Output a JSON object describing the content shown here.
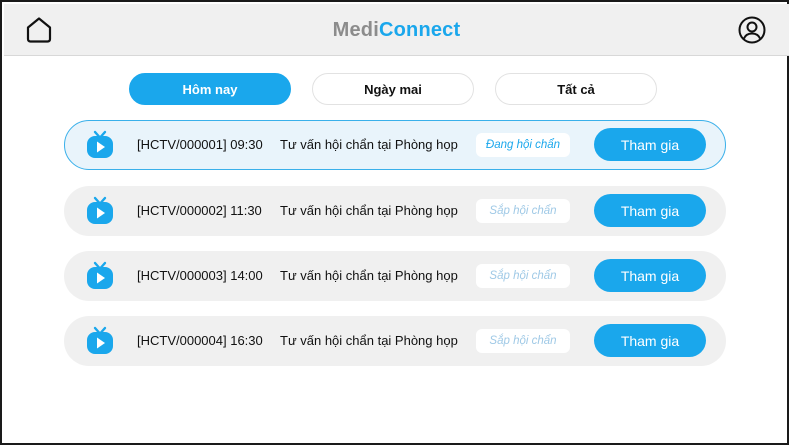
{
  "app": {
    "logo_part1": "Medi",
    "logo_part2": "Connect",
    "brand_color": "#1aa7ec"
  },
  "header": {
    "home_icon": "home-icon",
    "profile_icon": "user-circle-icon"
  },
  "tabs": [
    {
      "label": "Hôm nay",
      "active": true
    },
    {
      "label": "Ngày mai",
      "active": false
    },
    {
      "label": "Tất cả",
      "active": false
    }
  ],
  "sessions": [
    {
      "code": "[HCTV/000001] 09:30",
      "title": "Tư vấn hội chẩn tại Phòng họp",
      "status": "Đang hội chẩn",
      "status_type": "active",
      "action": "Tham gia",
      "icon": "tv-icon"
    },
    {
      "code": "[HCTV/000002] 11:30",
      "title": "Tư vấn hội chẩn tại Phòng họp",
      "status": "Sắp hội chẩn",
      "status_type": "pending",
      "action": "Tham gia",
      "icon": "tv-icon"
    },
    {
      "code": "[HCTV/000003] 14:00",
      "title": "Tư vấn hội chẩn tại Phòng họp",
      "status": "Sắp hội chẩn",
      "status_type": "pending",
      "action": "Tham gia",
      "icon": "tv-icon"
    },
    {
      "code": "[HCTV/000004] 16:30",
      "title": "Tư vấn hội chẩn tại Phòng họp",
      "status": "Sắp hội chẩn",
      "status_type": "pending",
      "action": "Tham gia",
      "icon": "tv-icon"
    }
  ]
}
